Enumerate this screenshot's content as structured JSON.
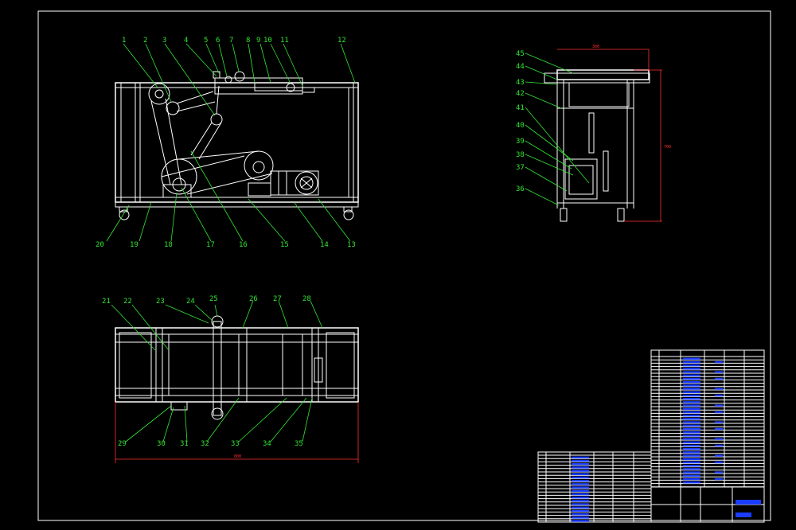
{
  "drawing": {
    "colors": {
      "background": "#000000",
      "outline": "#ffffff",
      "leader_labels": "#33e633",
      "dimensions": "#ff3030",
      "table_fill": "#1a3cff"
    },
    "views": {
      "front": {
        "labels": [
          "1",
          "2",
          "3",
          "4",
          "5",
          "6",
          "7",
          "8",
          "9",
          "10",
          "11",
          "12",
          "13",
          "14",
          "15",
          "16",
          "17",
          "18",
          "19",
          "20"
        ]
      },
      "top": {
        "labels": [
          "21",
          "22",
          "23",
          "24",
          "25",
          "26",
          "27",
          "28",
          "29",
          "30",
          "31",
          "32",
          "33",
          "34",
          "35"
        ]
      },
      "side": {
        "labels": [
          "36",
          "37",
          "38",
          "39",
          "40",
          "41",
          "42",
          "43",
          "44",
          "45"
        ]
      }
    }
  }
}
